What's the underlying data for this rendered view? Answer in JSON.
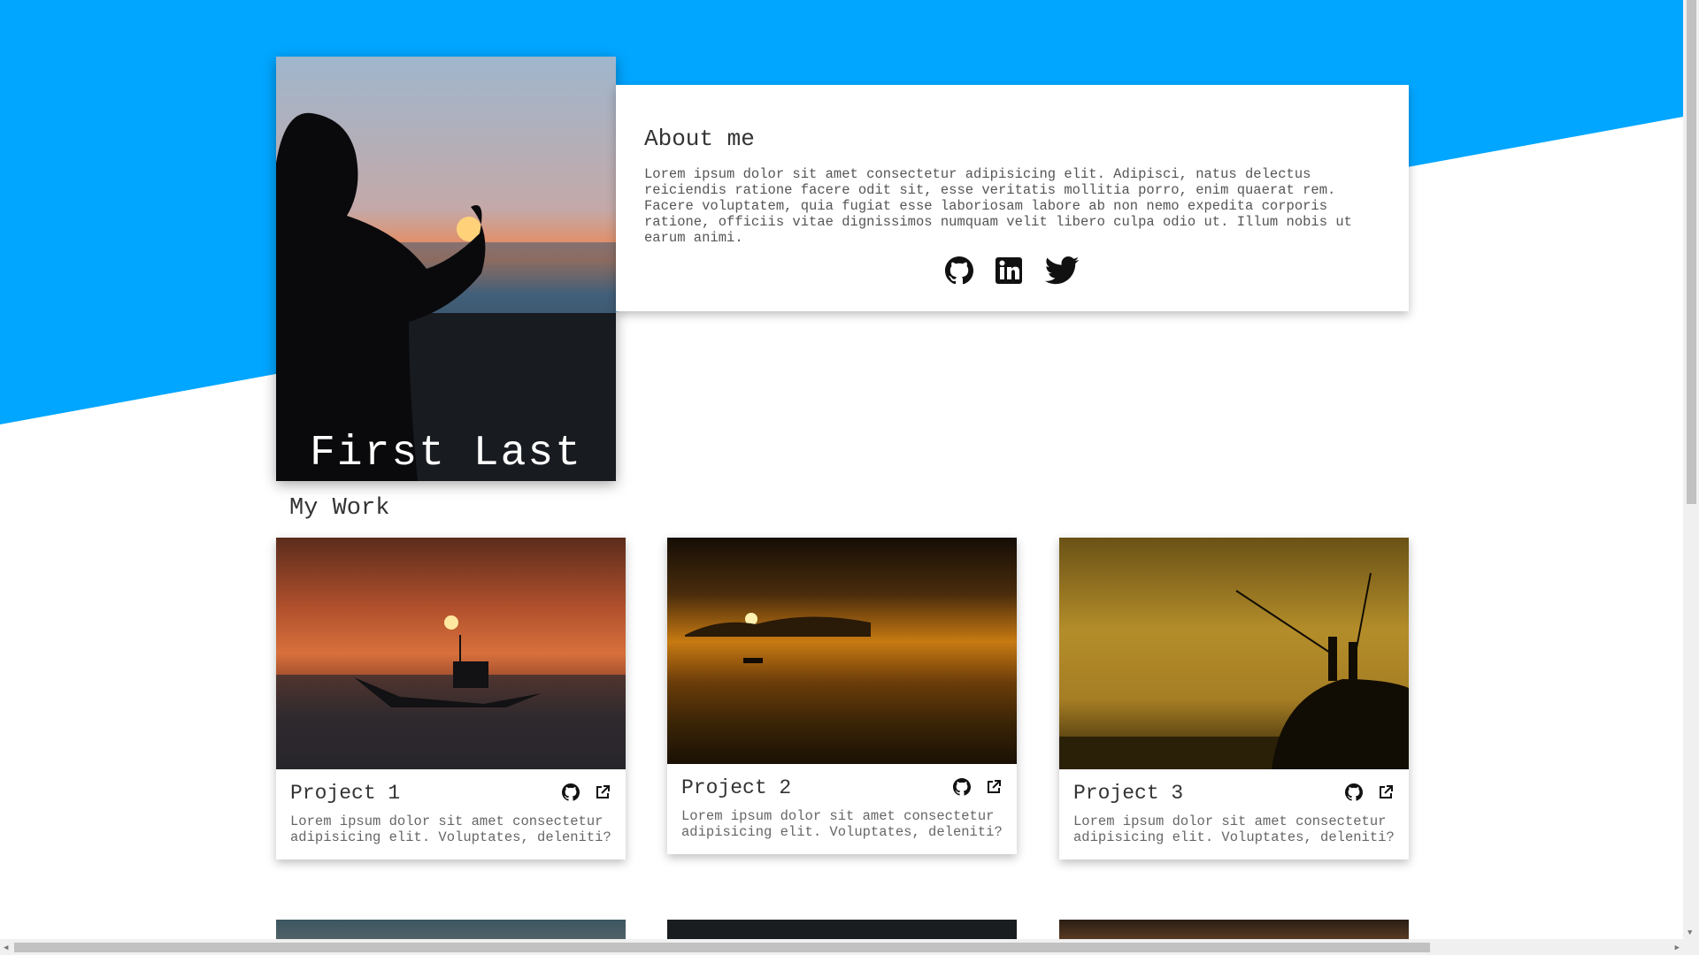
{
  "profile": {
    "name": "First Last"
  },
  "about": {
    "title": "About me",
    "text": "Lorem ipsum dolor sit amet consectetur adipisicing elit. Adipisci, natus delectus reiciendis ratione facere odit sit, esse veritatis mollitia porro, enim quaerat rem. Facere voluptatem, quia fugiat esse laboriosam labore ab non nemo expedita corporis ratione, officiis vitae dignissimos numquam velit libero culpa odio ut. Illum nobis ut earum animi.",
    "socials": [
      "github-icon",
      "linkedin-icon",
      "twitter-icon"
    ]
  },
  "work": {
    "title": "My Work",
    "projects": [
      {
        "title": "Project 1",
        "desc": "Lorem ipsum dolor sit amet consectetur adipisicing elit. Voluptates, deleniti?"
      },
      {
        "title": "Project 2",
        "desc": "Lorem ipsum dolor sit amet consectetur adipisicing elit. Voluptates, deleniti?"
      },
      {
        "title": "Project 3",
        "desc": "Lorem ipsum dolor sit amet consectetur adipisicing elit. Voluptates, deleniti?"
      }
    ]
  },
  "colors": {
    "accent": "#00a6ff",
    "card": "#ffffff"
  }
}
